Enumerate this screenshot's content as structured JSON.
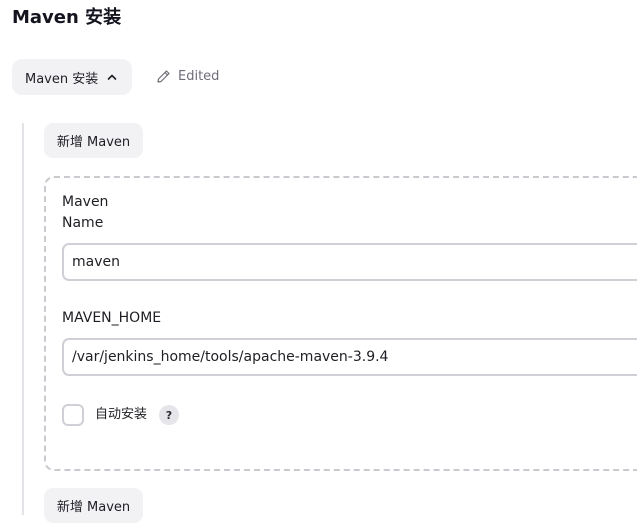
{
  "section": {
    "title": "Maven 安装"
  },
  "toolbar": {
    "toggle_label": "Maven 安装",
    "edited_label": "Edited"
  },
  "installer": {
    "add_label_top": "新增 Maven",
    "name_label_line1": "Maven",
    "name_label_line2": "Name",
    "name_value": "maven",
    "home_label": "MAVEN_HOME",
    "home_value": "/var/jenkins_home/tools/apache-maven-3.9.4",
    "auto_install_label": "自动安装",
    "help_symbol": "?",
    "auto_install_checked": false,
    "add_label_bottom": "新增 Maven"
  },
  "icons": {
    "toggle": "chevron-up-icon",
    "edited": "pencil-icon",
    "help": "help-icon"
  }
}
